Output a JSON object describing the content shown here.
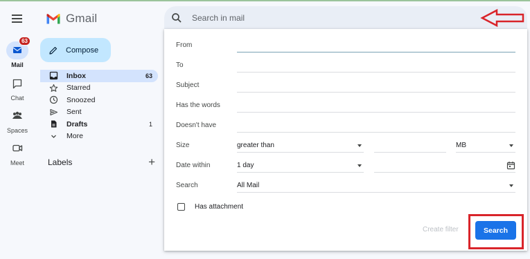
{
  "app": {
    "brand": "Gmail"
  },
  "rail": {
    "items": [
      {
        "label": "Mail",
        "badge": "63",
        "icon": "mail-icon"
      },
      {
        "label": "Chat",
        "icon": "chat-icon"
      },
      {
        "label": "Spaces",
        "icon": "spaces-icon"
      },
      {
        "label": "Meet",
        "icon": "meet-icon"
      }
    ]
  },
  "compose": {
    "label": "Compose"
  },
  "nav": {
    "items": [
      {
        "label": "Inbox",
        "count": "63",
        "icon": "inbox-icon"
      },
      {
        "label": "Starred",
        "icon": "star-icon"
      },
      {
        "label": "Snoozed",
        "icon": "clock-icon"
      },
      {
        "label": "Sent",
        "icon": "send-icon"
      },
      {
        "label": "Drafts",
        "count": "1",
        "icon": "draft-icon"
      },
      {
        "label": "More",
        "icon": "chevron-down-icon"
      }
    ],
    "labels_title": "Labels"
  },
  "search": {
    "placeholder": "Search in mail"
  },
  "advanced": {
    "from_label": "From",
    "to_label": "To",
    "subject_label": "Subject",
    "has_words_label": "Has the words",
    "doesnt_have_label": "Doesn't have",
    "size_label": "Size",
    "size_operator": "greater than",
    "size_unit": "MB",
    "date_within_label": "Date within",
    "date_within_value": "1 day",
    "search_in_label": "Search",
    "search_in_value": "All Mail",
    "has_attachment_label": "Has attachment",
    "create_filter_label": "Create filter",
    "search_button_label": "Search"
  },
  "colors": {
    "accent": "#1a73e8",
    "highlight": "#d9242a",
    "nav_active": "#d3e3fd",
    "compose_bg": "#c2e7ff"
  }
}
